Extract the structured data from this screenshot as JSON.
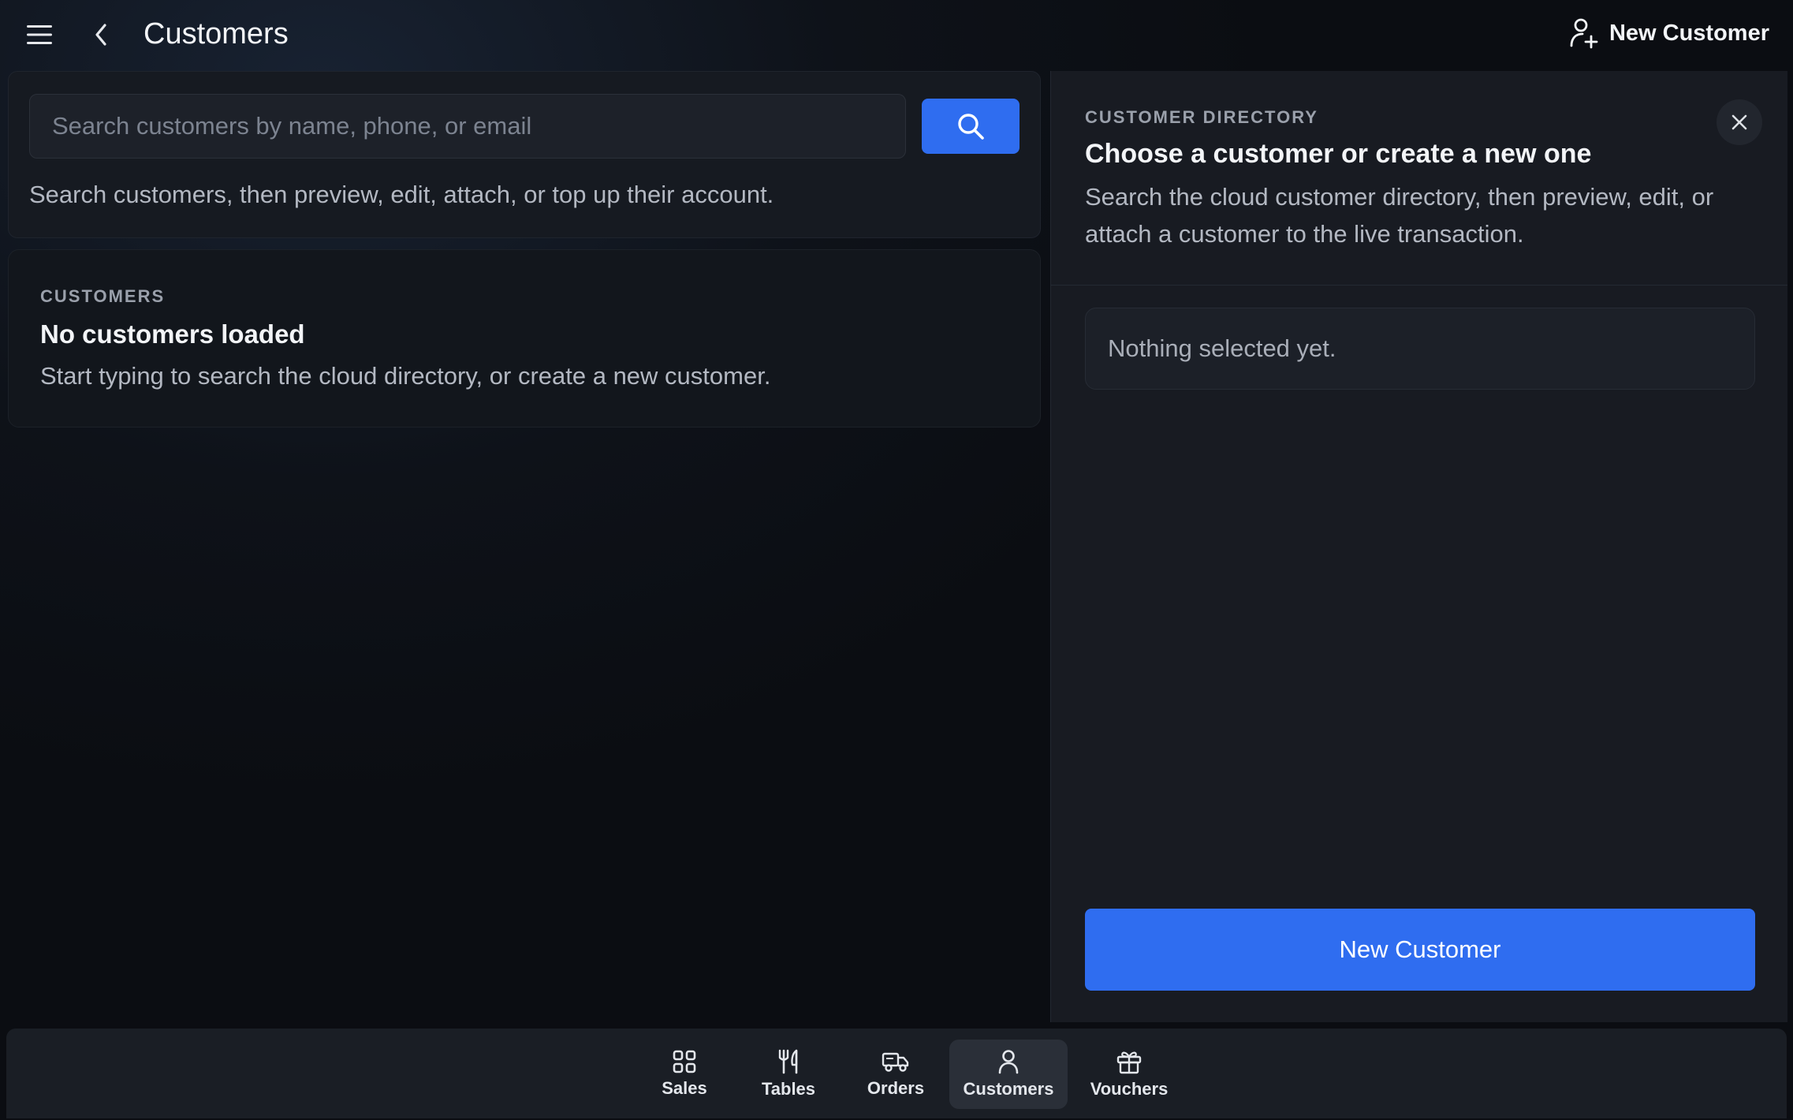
{
  "header": {
    "title": "Customers",
    "new_customer_label": "New Customer"
  },
  "search": {
    "placeholder": "Search customers by name, phone, or email",
    "value": "",
    "help_text": "Search customers, then preview, edit, attach, or top up their account."
  },
  "customers_section": {
    "label": "CUSTOMERS",
    "empty_title": "No customers loaded",
    "empty_description": "Start typing to search the cloud directory, or create a new customer."
  },
  "directory_panel": {
    "label": "CUSTOMER DIRECTORY",
    "title": "Choose a customer or create a new one",
    "description": "Search the cloud customer directory, then preview, edit, or attach a customer to the live transaction.",
    "selection_placeholder": "Nothing selected yet.",
    "primary_button_label": "New Customer"
  },
  "bottom_nav": {
    "items": [
      {
        "label": "Sales",
        "icon": "grid-icon"
      },
      {
        "label": "Tables",
        "icon": "fork-knife-icon"
      },
      {
        "label": "Orders",
        "icon": "truck-icon"
      },
      {
        "label": "Customers",
        "icon": "user-icon",
        "active": true
      },
      {
        "label": "Vouchers",
        "icon": "gift-icon"
      }
    ]
  },
  "colors": {
    "accent": "#2f6df0",
    "background": "#0e1219",
    "panel": "#181b22"
  }
}
